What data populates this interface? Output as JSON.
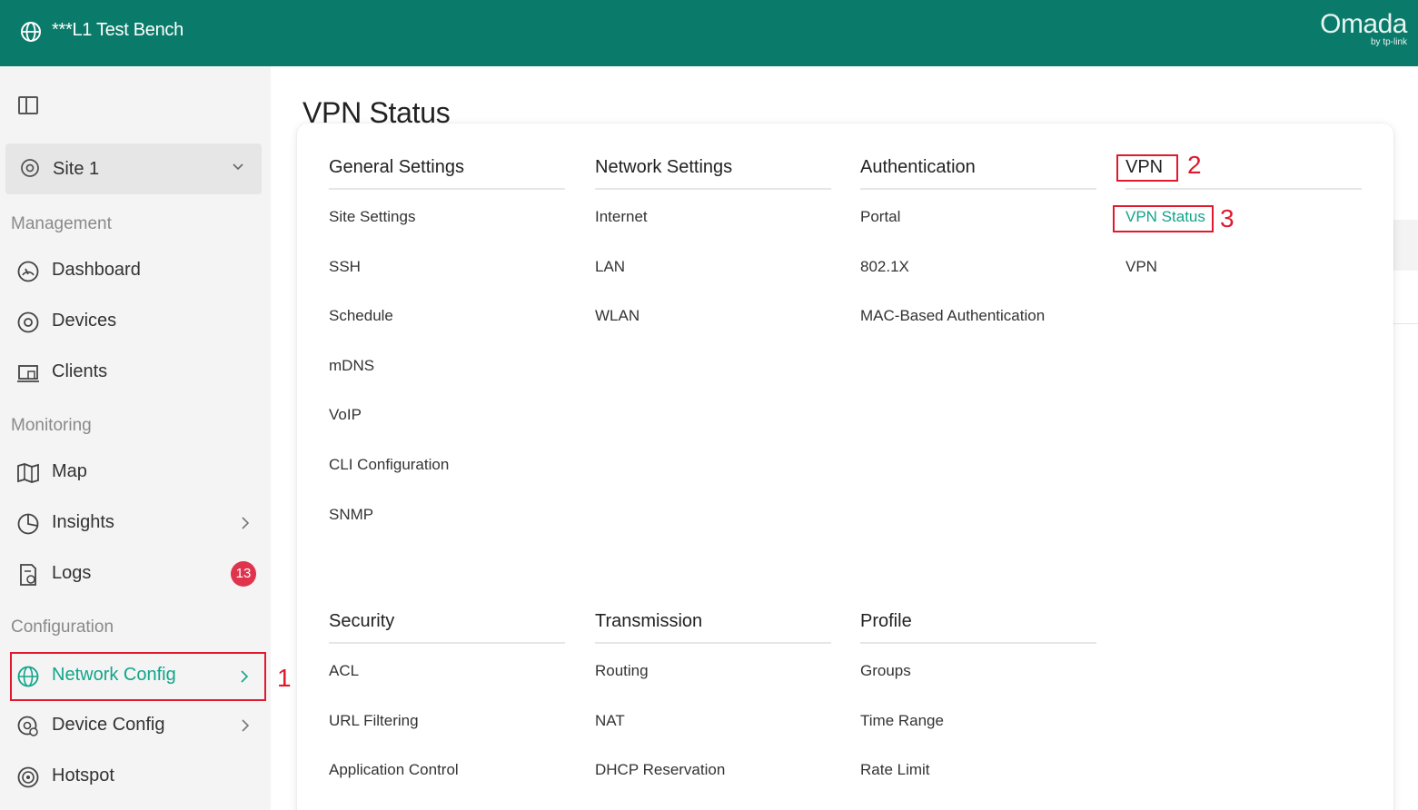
{
  "header": {
    "site_title": "***L1 Test Bench",
    "logo_main": "Omada",
    "logo_sub": "by tp-link",
    "bg_color": "#0a7b6a"
  },
  "sidebar": {
    "site_selector": "Site 1",
    "sections": {
      "management": "Management",
      "monitoring": "Monitoring",
      "configuration": "Configuration"
    },
    "items": {
      "dashboard": "Dashboard",
      "devices": "Devices",
      "clients": "Clients",
      "map": "Map",
      "insights": "Insights",
      "logs": "Logs",
      "logs_badge": "13",
      "network_config": "Network Config",
      "device_config": "Device Config",
      "hotspot": "Hotspot"
    },
    "active_item": "network_config"
  },
  "main": {
    "page_title": "VPN Status",
    "menu": {
      "general_settings": {
        "title": "General Settings",
        "items": [
          "Site Settings",
          "SSH",
          "Schedule",
          "mDNS",
          "VoIP",
          "CLI Configuration",
          "SNMP"
        ]
      },
      "network_settings": {
        "title": "Network Settings",
        "items": [
          "Internet",
          "LAN",
          "WLAN"
        ]
      },
      "authentication": {
        "title": "Authentication",
        "items": [
          "Portal",
          "802.1X",
          "MAC-Based Authentication"
        ]
      },
      "vpn": {
        "title": "VPN",
        "items": [
          "VPN Status",
          "VPN"
        ],
        "current": "VPN Status"
      },
      "security": {
        "title": "Security",
        "items": [
          "ACL",
          "URL Filtering",
          "Application Control"
        ]
      },
      "transmission": {
        "title": "Transmission",
        "items": [
          "Routing",
          "NAT",
          "DHCP Reservation"
        ]
      },
      "profile": {
        "title": "Profile",
        "items": [
          "Groups",
          "Time Range",
          "Rate Limit"
        ]
      }
    }
  },
  "annotations": {
    "step1": "1",
    "step2": "2",
    "step3": "3",
    "color": "#e0192e"
  },
  "colors": {
    "accent": "#11a58a",
    "badge": "#e0344e"
  }
}
